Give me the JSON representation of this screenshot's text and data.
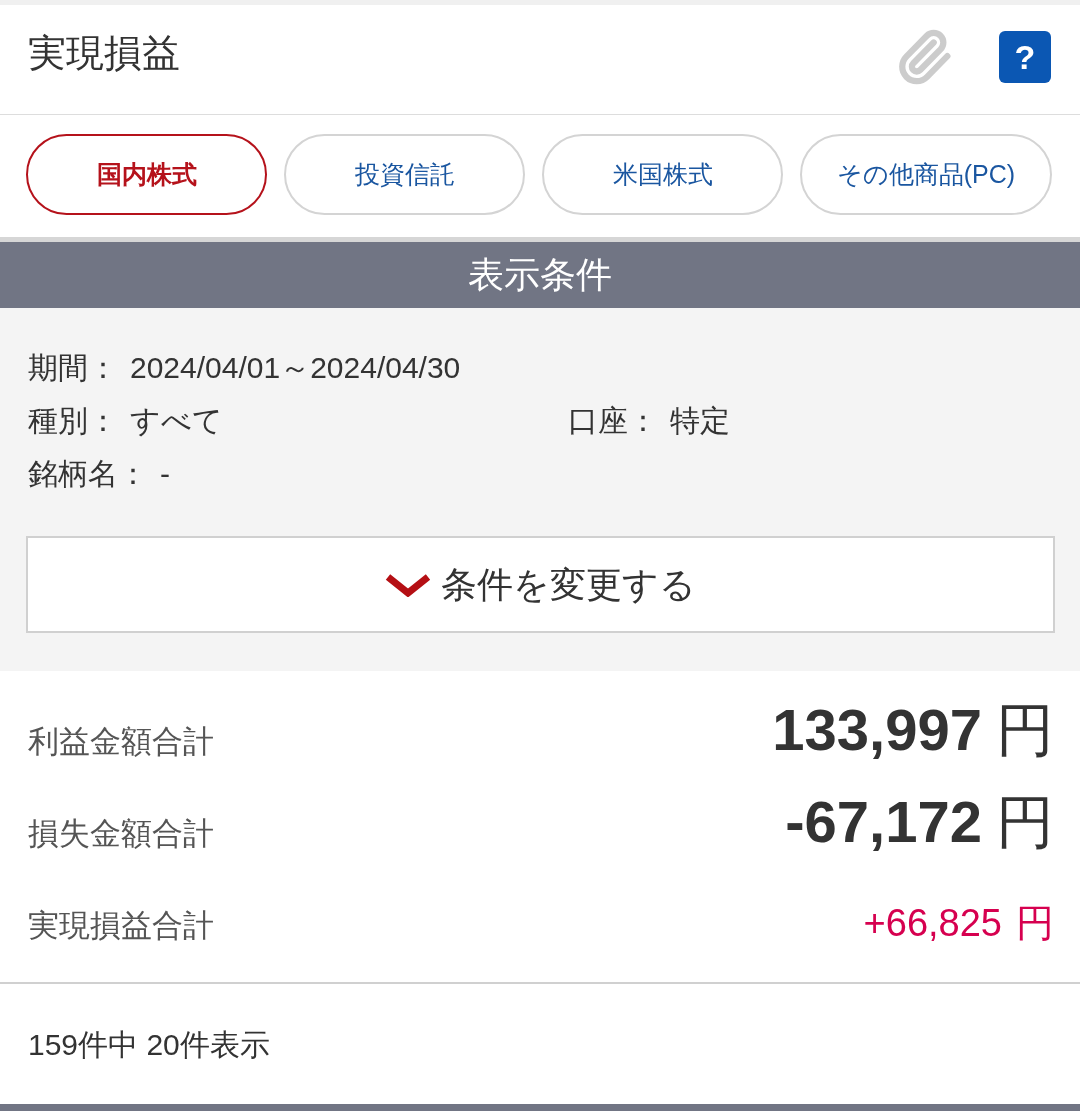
{
  "header": {
    "title": "実現損益",
    "help_button": "?"
  },
  "tabs": [
    {
      "label": "国内株式",
      "selected": true
    },
    {
      "label": "投資信託",
      "selected": false
    },
    {
      "label": "米国株式",
      "selected": false
    },
    {
      "label": "その他商品(PC)",
      "selected": false
    }
  ],
  "conditions": {
    "title": "表示条件",
    "rows": [
      {
        "items": [
          {
            "label": "期間：",
            "value": "2024/04/01～2024/04/30"
          }
        ]
      },
      {
        "items": [
          {
            "label": "種別：",
            "value": "すべて"
          },
          {
            "label": "口座：",
            "value": "特定"
          }
        ]
      },
      {
        "items": [
          {
            "label": "銘柄名：",
            "value": "-"
          }
        ]
      }
    ],
    "change_button": "条件を変更する"
  },
  "totals": [
    {
      "kind": "large",
      "label": "利益金額合計",
      "amount": "133,997",
      "unit": "円"
    },
    {
      "kind": "large",
      "label": "損失金額合計",
      "amount": "-67,172",
      "unit": "円"
    },
    {
      "kind": "net",
      "label": "実現損益合計",
      "amount": "+66,825",
      "unit": "円"
    }
  ],
  "result_count": "159件中 20件表示"
}
